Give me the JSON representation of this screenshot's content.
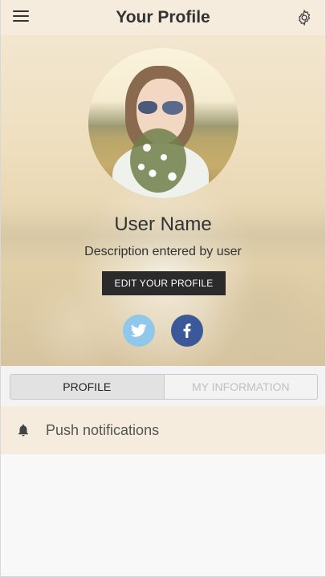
{
  "header": {
    "title": "Your Profile",
    "menu_icon": "hamburger-menu-icon",
    "settings_icon": "gear-icon"
  },
  "profile": {
    "user_name": "User Name",
    "description": "Description entered by user",
    "edit_button_label": "EDIT YOUR PROFILE"
  },
  "social": [
    {
      "name": "twitter",
      "icon": "twitter-icon",
      "color": "#8fc8ea"
    },
    {
      "name": "facebook",
      "icon": "facebook-icon",
      "color": "#3b5998"
    }
  ],
  "tabs": [
    {
      "label": "PROFILE",
      "active": true
    },
    {
      "label": "MY INFORMATION",
      "active": false
    }
  ],
  "settings_list": [
    {
      "label": "Push notifications",
      "icon": "bell-icon"
    }
  ],
  "colors": {
    "header_bg": "#f5ecdd",
    "button_bg": "#2b2b2b",
    "row_bg": "#f5ecdd"
  }
}
